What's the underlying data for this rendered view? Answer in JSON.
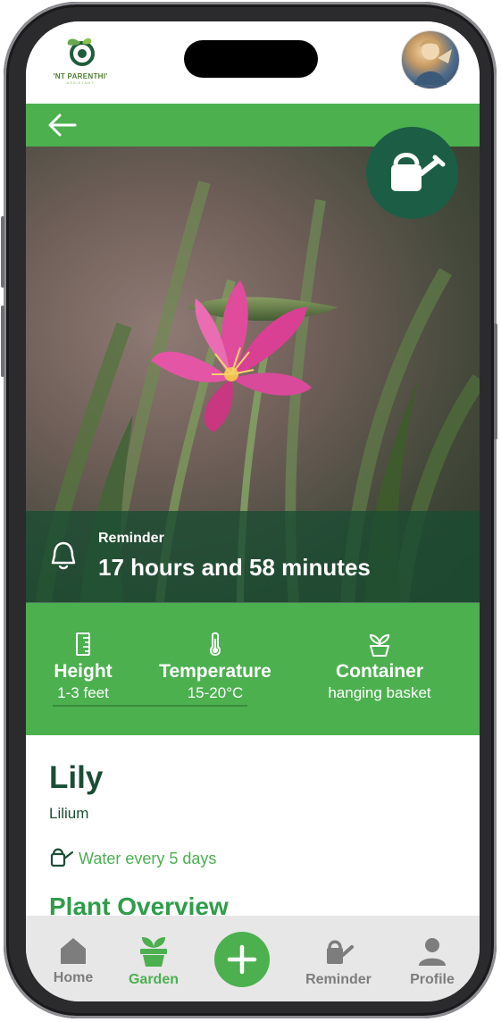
{
  "header": {
    "logo_text": "'NT PARENTHI'",
    "logo_subtext": "ASSISTANT",
    "avatar_icon": "user-avatar"
  },
  "nav": {
    "back_icon": "arrow-left-icon"
  },
  "hero": {
    "image_subject": "pink lily flower",
    "water_button_icon": "watering-can-icon"
  },
  "reminder": {
    "label": "Reminder",
    "value": "17 hours and 58 minutes",
    "icon": "bell-icon"
  },
  "stats": [
    {
      "icon": "ruler-icon",
      "title": "Height",
      "value": "1-3 feet"
    },
    {
      "icon": "thermometer-icon",
      "title": "Temperature",
      "value": "15-20°C"
    },
    {
      "icon": "plant-pot-icon",
      "title": "Container",
      "value": "hanging basket"
    }
  ],
  "plant": {
    "name": "Lily",
    "latin": "Lilium",
    "watering": "Water every 5 days",
    "overview_title": "Plant Overview"
  },
  "bottom_nav": [
    {
      "label": "Home",
      "icon": "home-icon",
      "active": false
    },
    {
      "label": "Garden",
      "icon": "plant-pot-icon",
      "active": true
    },
    {
      "label": "",
      "icon": "plus-icon",
      "active": false
    },
    {
      "label": "Reminder",
      "icon": "watering-can-icon",
      "active": false
    },
    {
      "label": "Profile",
      "icon": "person-icon",
      "active": false
    }
  ],
  "colors": {
    "primary_green": "#4cb04f",
    "dark_green": "#1b5e45",
    "text_dark_green": "#1b4d35"
  }
}
